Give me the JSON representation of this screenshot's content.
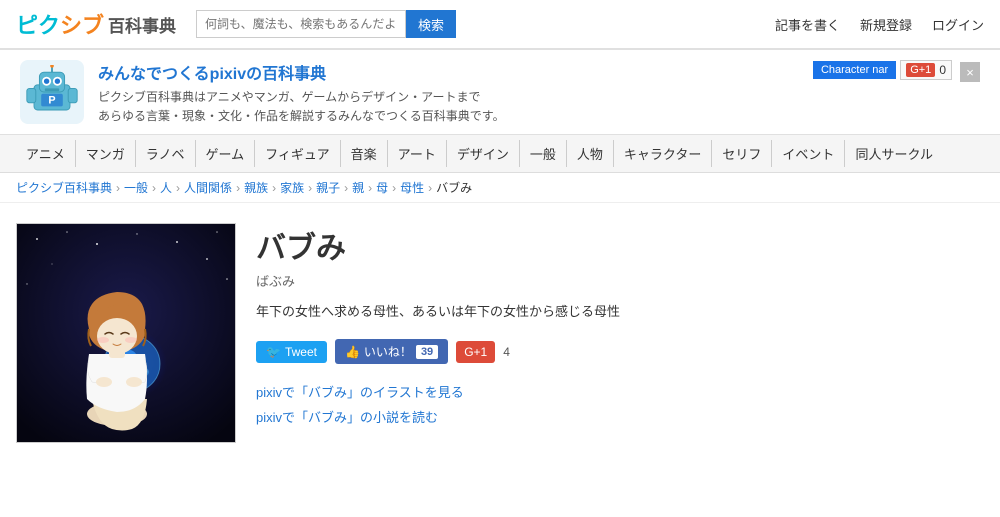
{
  "header": {
    "logo": "ピクシブ百科事典",
    "search_placeholder": "何詞も、魔法も、検索もあるんだよ",
    "search_button": "検索",
    "nav_right": [
      "記事を書く",
      "新規登録",
      "ログイン"
    ]
  },
  "banner": {
    "title": "みんなでつくるpixivの百科事典",
    "description_line1": "ピクシブ百科事典はアニメやマンガ、ゲームからデザイン・アートまで",
    "description_line2": "あらゆる言葉・現象・文化・作品を解説するみんなでつくる百科事典です。",
    "char_btn": "Character nar",
    "g1_label": "G+1",
    "g1_count": "0",
    "close_btn": "×"
  },
  "navbar": {
    "items": [
      "アニメ",
      "マンガ",
      "ラノベ",
      "ゲーム",
      "フィギュア",
      "音楽",
      "アート",
      "デザイン",
      "一般",
      "人物",
      "キャラクター",
      "セリフ",
      "イベント",
      "同人サークル"
    ]
  },
  "breadcrumb": {
    "items": [
      "ピクシブ百科事典",
      "一般",
      "人",
      "人間関係",
      "親族",
      "家族",
      "親子",
      "親",
      "母",
      "母性"
    ],
    "current": "バブみ"
  },
  "article": {
    "title": "バブみ",
    "reading": "ばぶみ",
    "description": "年下の女性へ求める母性、あるいは年下の女性から感じる母性",
    "tweet_label": "Tweet",
    "like_label": "いいね！",
    "like_count": "39",
    "g1_label": "G+1",
    "g1_count": "4",
    "link1": "pixivで「バブみ」のイラストを見る",
    "link2": "pixivで「バブみ」の小説を読む"
  }
}
